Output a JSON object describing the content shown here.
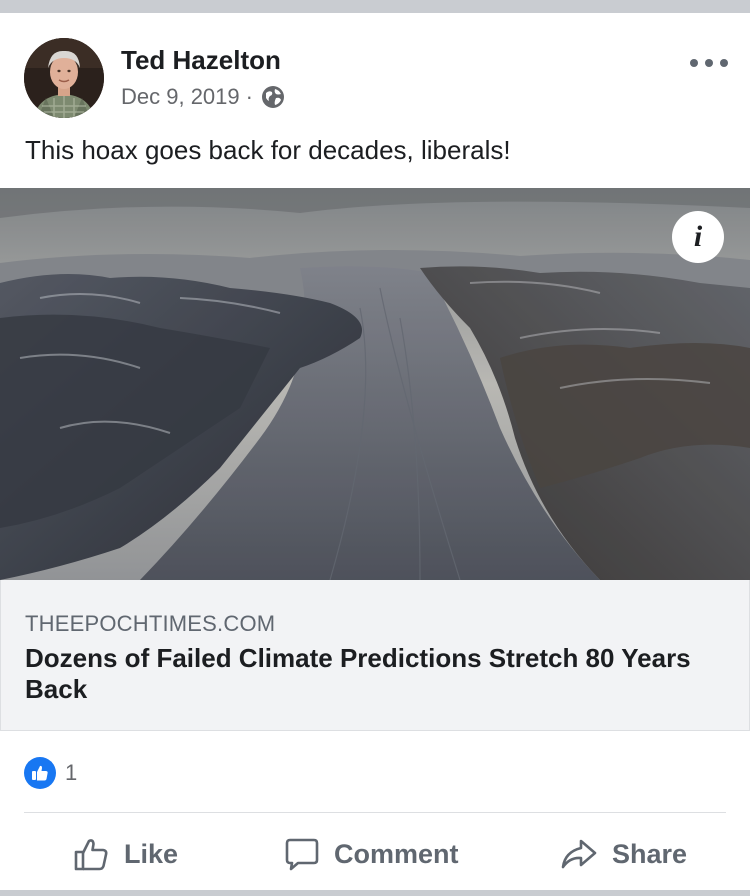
{
  "post": {
    "author": "Ted Hazelton",
    "date": "Dec 9, 2019",
    "separator": "·",
    "privacy_icon": "globe-icon",
    "text": "This hoax goes back for decades, liberals!"
  },
  "link": {
    "domain": "THEEPOCHTIMES.COM",
    "title": "Dozens of Failed Climate Predictions Stretch 80 Years Back",
    "info_label": "i"
  },
  "reactions": {
    "icon": "thumbs-up-icon",
    "count": "1"
  },
  "actions": {
    "like": "Like",
    "comment": "Comment",
    "share": "Share"
  },
  "colors": {
    "accent": "#1877f2",
    "text": "#1c1e21",
    "secondary": "#65676b",
    "link_box": "#f2f3f5"
  }
}
